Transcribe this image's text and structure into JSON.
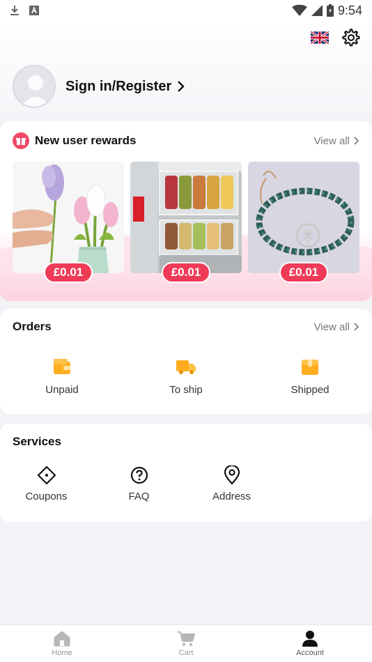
{
  "status_bar": {
    "time": "9:54",
    "icons": [
      "download-icon",
      "a-icon",
      "wifi-icon",
      "signal-icon",
      "battery-icon"
    ]
  },
  "header": {
    "icons": [
      "uk-flag-icon",
      "gear-icon"
    ]
  },
  "profile": {
    "signin_label": "Sign in/Register"
  },
  "rewards": {
    "title": "New user rewards",
    "view_all": "View all",
    "products": [
      {
        "name": "felt flowers",
        "price": "£0.01"
      },
      {
        "name": "jar storage bags",
        "price": "£0.01"
      },
      {
        "name": "bead bracelet",
        "price": "£0.01"
      }
    ]
  },
  "orders": {
    "title": "Orders",
    "view_all": "View all",
    "items": [
      {
        "label": "Unpaid",
        "icon": "wallet-icon"
      },
      {
        "label": "To ship",
        "icon": "truck-icon"
      },
      {
        "label": "Shipped",
        "icon": "box-icon"
      }
    ]
  },
  "services": {
    "title": "Services",
    "items": [
      {
        "label": "Coupons",
        "icon": "coupon-icon"
      },
      {
        "label": "FAQ",
        "icon": "question-icon"
      },
      {
        "label": "Address",
        "icon": "location-icon"
      }
    ]
  },
  "bottom_nav": {
    "items": [
      {
        "label": "Home",
        "icon": "home-icon"
      },
      {
        "label": "Cart",
        "icon": "cart-icon"
      },
      {
        "label": "Account",
        "icon": "person-icon",
        "active": true
      }
    ]
  },
  "colors": {
    "accent": "#ef3b58",
    "order_icon": "#ffad1f"
  }
}
